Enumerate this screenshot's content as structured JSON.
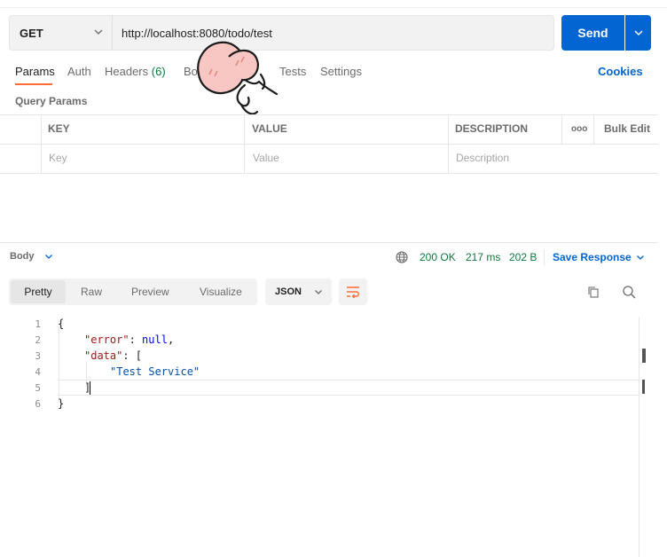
{
  "request": {
    "method": "GET",
    "url": "http://localhost:8080/todo/test",
    "send_label": "Send"
  },
  "tabs": [
    {
      "label": "Params"
    },
    {
      "label": "Auth"
    },
    {
      "label": "Headers",
      "count": "(6)"
    },
    {
      "label": "Bo"
    },
    {
      "label": "Tests"
    },
    {
      "label": "Settings"
    }
  ],
  "cookies_label": "Cookies",
  "query_params": {
    "label": "Query Params",
    "columns": [
      "KEY",
      "VALUE",
      "DESCRIPTION"
    ],
    "more_label": "ooo",
    "bulk_edit_label": "Bulk Edit",
    "placeholders": [
      "Key",
      "Value",
      "Description"
    ]
  },
  "response": {
    "body_label": "Body",
    "status": "200 OK",
    "time": "217 ms",
    "size": "202 B",
    "save_label": "Save Response",
    "view_modes": [
      "Pretty",
      "Raw",
      "Preview",
      "Visualize"
    ],
    "format": "JSON",
    "line_numbers": [
      "1",
      "2",
      "3",
      "4",
      "5",
      "6"
    ],
    "code": {
      "l1": "{",
      "l2_key": "\"error\"",
      "l2_colon": ": ",
      "l2_val": "null",
      "l2_comma": ",",
      "l3_key": "\"data\"",
      "l3_rest": ": [",
      "l4_val": "\"Test Service\"",
      "l5": "]",
      "l6": "}"
    }
  },
  "colors": {
    "accent": "#0265d2",
    "active_tab": "#ff6c37",
    "success": "#0b7a3e"
  },
  "icons": [
    "chevron-down-icon",
    "globe-icon",
    "wrap-lines-icon",
    "copy-icon",
    "search-icon"
  ]
}
